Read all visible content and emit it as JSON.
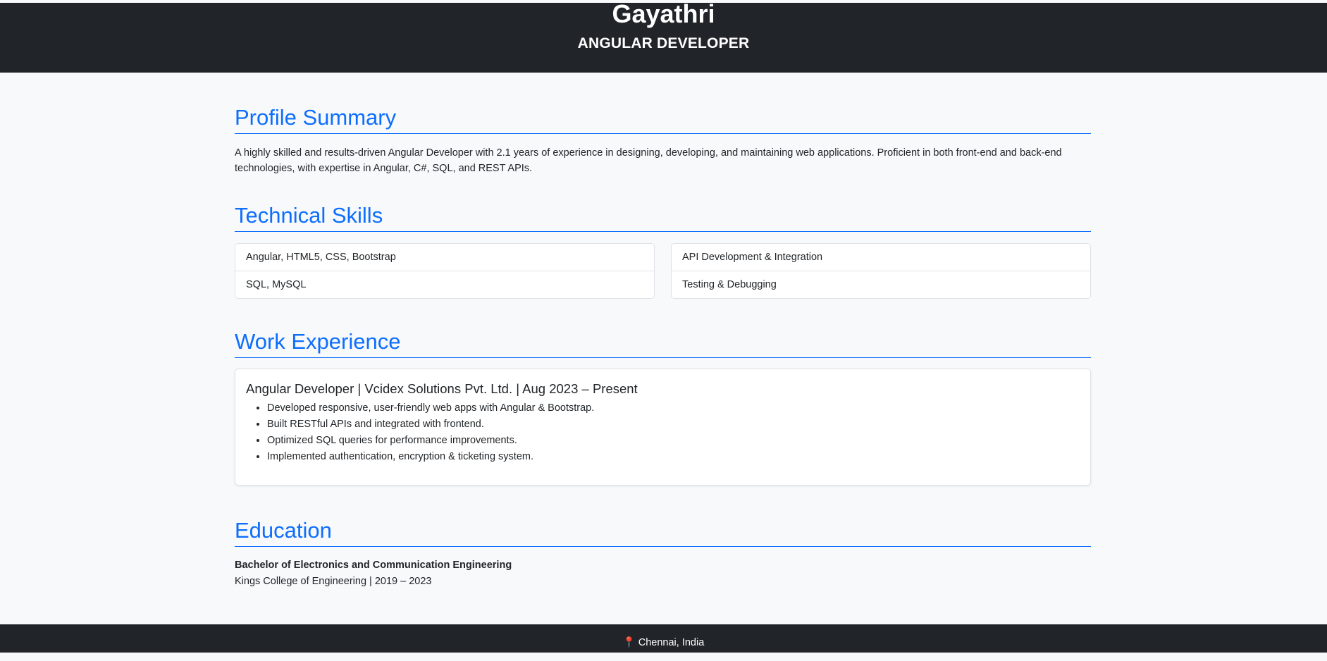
{
  "header": {
    "name": "Gayathri",
    "role": "ANGULAR DEVELOPER"
  },
  "profile": {
    "title": "Profile Summary",
    "text": "A highly skilled and results-driven Angular Developer with 2.1 years of experience in designing, developing, and maintaining web applications. Proficient in both front-end and back-end technologies, with expertise in Angular, C#, SQL, and REST APIs."
  },
  "skills": {
    "title": "Technical Skills",
    "left": [
      "Angular, HTML5, CSS, Bootstrap",
      "SQL, MySQL"
    ],
    "right": [
      "API Development & Integration",
      "Testing & Debugging"
    ]
  },
  "experience": {
    "title": "Work Experience",
    "job_title": "Angular Developer | Vcidex Solutions Pvt. Ltd. | Aug 2023 – Present",
    "bullets": [
      "Developed responsive, user-friendly web apps with Angular & Bootstrap.",
      "Built RESTful APIs and integrated with frontend.",
      "Optimized SQL queries for performance improvements.",
      "Implemented authentication, encryption & ticketing system."
    ]
  },
  "education": {
    "title": "Education",
    "degree": "Bachelor of Electronics and Communication Engineering",
    "school": "Kings College of Engineering | 2019 – 2023"
  },
  "footer": {
    "icon": "map-pin-icon",
    "location": "Chennai, India"
  }
}
